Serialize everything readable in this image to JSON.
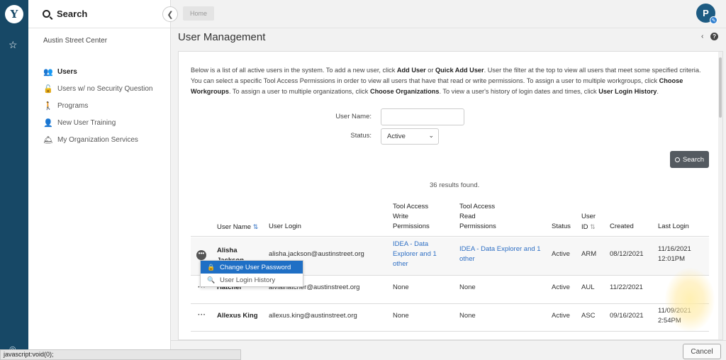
{
  "rail": {
    "logo": "Y",
    "star": "☆",
    "help": "◎"
  },
  "sidebar": {
    "title": "Search",
    "org": "Austin Street Center",
    "items": [
      {
        "label": "Users",
        "icon": "users-icon",
        "glyph": "👥"
      },
      {
        "label": "Users w/ no Security Question",
        "icon": "lock-icon",
        "glyph": "🔓"
      },
      {
        "label": "Programs",
        "icon": "walking-person-icon",
        "glyph": "🚶"
      },
      {
        "label": "New User Training",
        "icon": "person-icon",
        "glyph": "👤"
      },
      {
        "label": "My Organization Services",
        "icon": "service-bell-icon",
        "glyph": "🛎"
      }
    ]
  },
  "topbar": {
    "breadcrumb": "Home",
    "avatar_initial": "P"
  },
  "page": {
    "title": "User Management"
  },
  "intro": {
    "p1": "Below is a list of all active users in the system.  To add a new user, click ",
    "b1": "Add User",
    "p2": " or ",
    "b2": "Quick Add User",
    "p3": ".  User the filter at the top to view all users that meet some specified criteria.  You can select a specific Tool Access Permissions in order to view all users that have that read or write permissions.  To assign a user to multiple workgroups, click ",
    "b3": "Choose Workgroups",
    "p4": ".  To assign a user to multiple organizations, click ",
    "b4": "Choose Organizations",
    "p5": ".  To view a user's history of login dates and times, click ",
    "b5": "User Login History",
    "p6": "."
  },
  "filters": {
    "username_label": "User Name:",
    "username_value": "",
    "status_label": "Status:",
    "status_value": "Active",
    "search_label": "Search"
  },
  "results_text": "36 results found.",
  "table": {
    "headers": {
      "user_name": "User Name",
      "user_login": "User Login",
      "write_l1": "Tool Access",
      "write_l2": "Write",
      "write_l3": "Permissions",
      "read_l1": "Tool Access",
      "read_l2": "Read",
      "read_l3": "Permissions",
      "status": "Status",
      "userid_l1": "User",
      "userid_l2": "ID",
      "created": "Created",
      "last_login": "Last Login"
    },
    "rows": [
      {
        "name_l1": "Alisha",
        "name_l2": "Jackson",
        "login": "alisha.jackson@austinstreet.org",
        "write_l1": "IDEA - Data",
        "write_l2": "Explorer and 1",
        "write_l3": "other",
        "read_l1": "IDEA - Data Explorer and 1",
        "read_l2": "other",
        "status": "Active",
        "user_id": "ARM",
        "created": "08/12/2021",
        "last_login_l1": "11/16/2021",
        "last_login_l2": "12:01PM"
      },
      {
        "name_l1": "",
        "name_l2": "Hatcher",
        "login": "alvialhatcher@austinstreet.org",
        "write": "None",
        "read": "None",
        "status": "Active",
        "user_id": "AUL",
        "created": "11/22/2021",
        "last_login": ""
      },
      {
        "name": "Allexus King",
        "login": "allexus.king@austinstreet.org",
        "write": "None",
        "read": "None",
        "status": "Active",
        "user_id": "ASC",
        "created": "09/16/2021",
        "last_login_l1": "11/09/2021",
        "last_login_l2": "2:54PM"
      }
    ]
  },
  "row_menu": {
    "items": [
      {
        "label": "Change User Password",
        "icon": "lock-icon",
        "glyph": "🔒"
      },
      {
        "label": "User Login History",
        "icon": "search-icon",
        "glyph": "🔍"
      }
    ]
  },
  "footer": {
    "cancel_label": "Cancel"
  },
  "status_bar": {
    "url": "javascript:void(0);"
  }
}
